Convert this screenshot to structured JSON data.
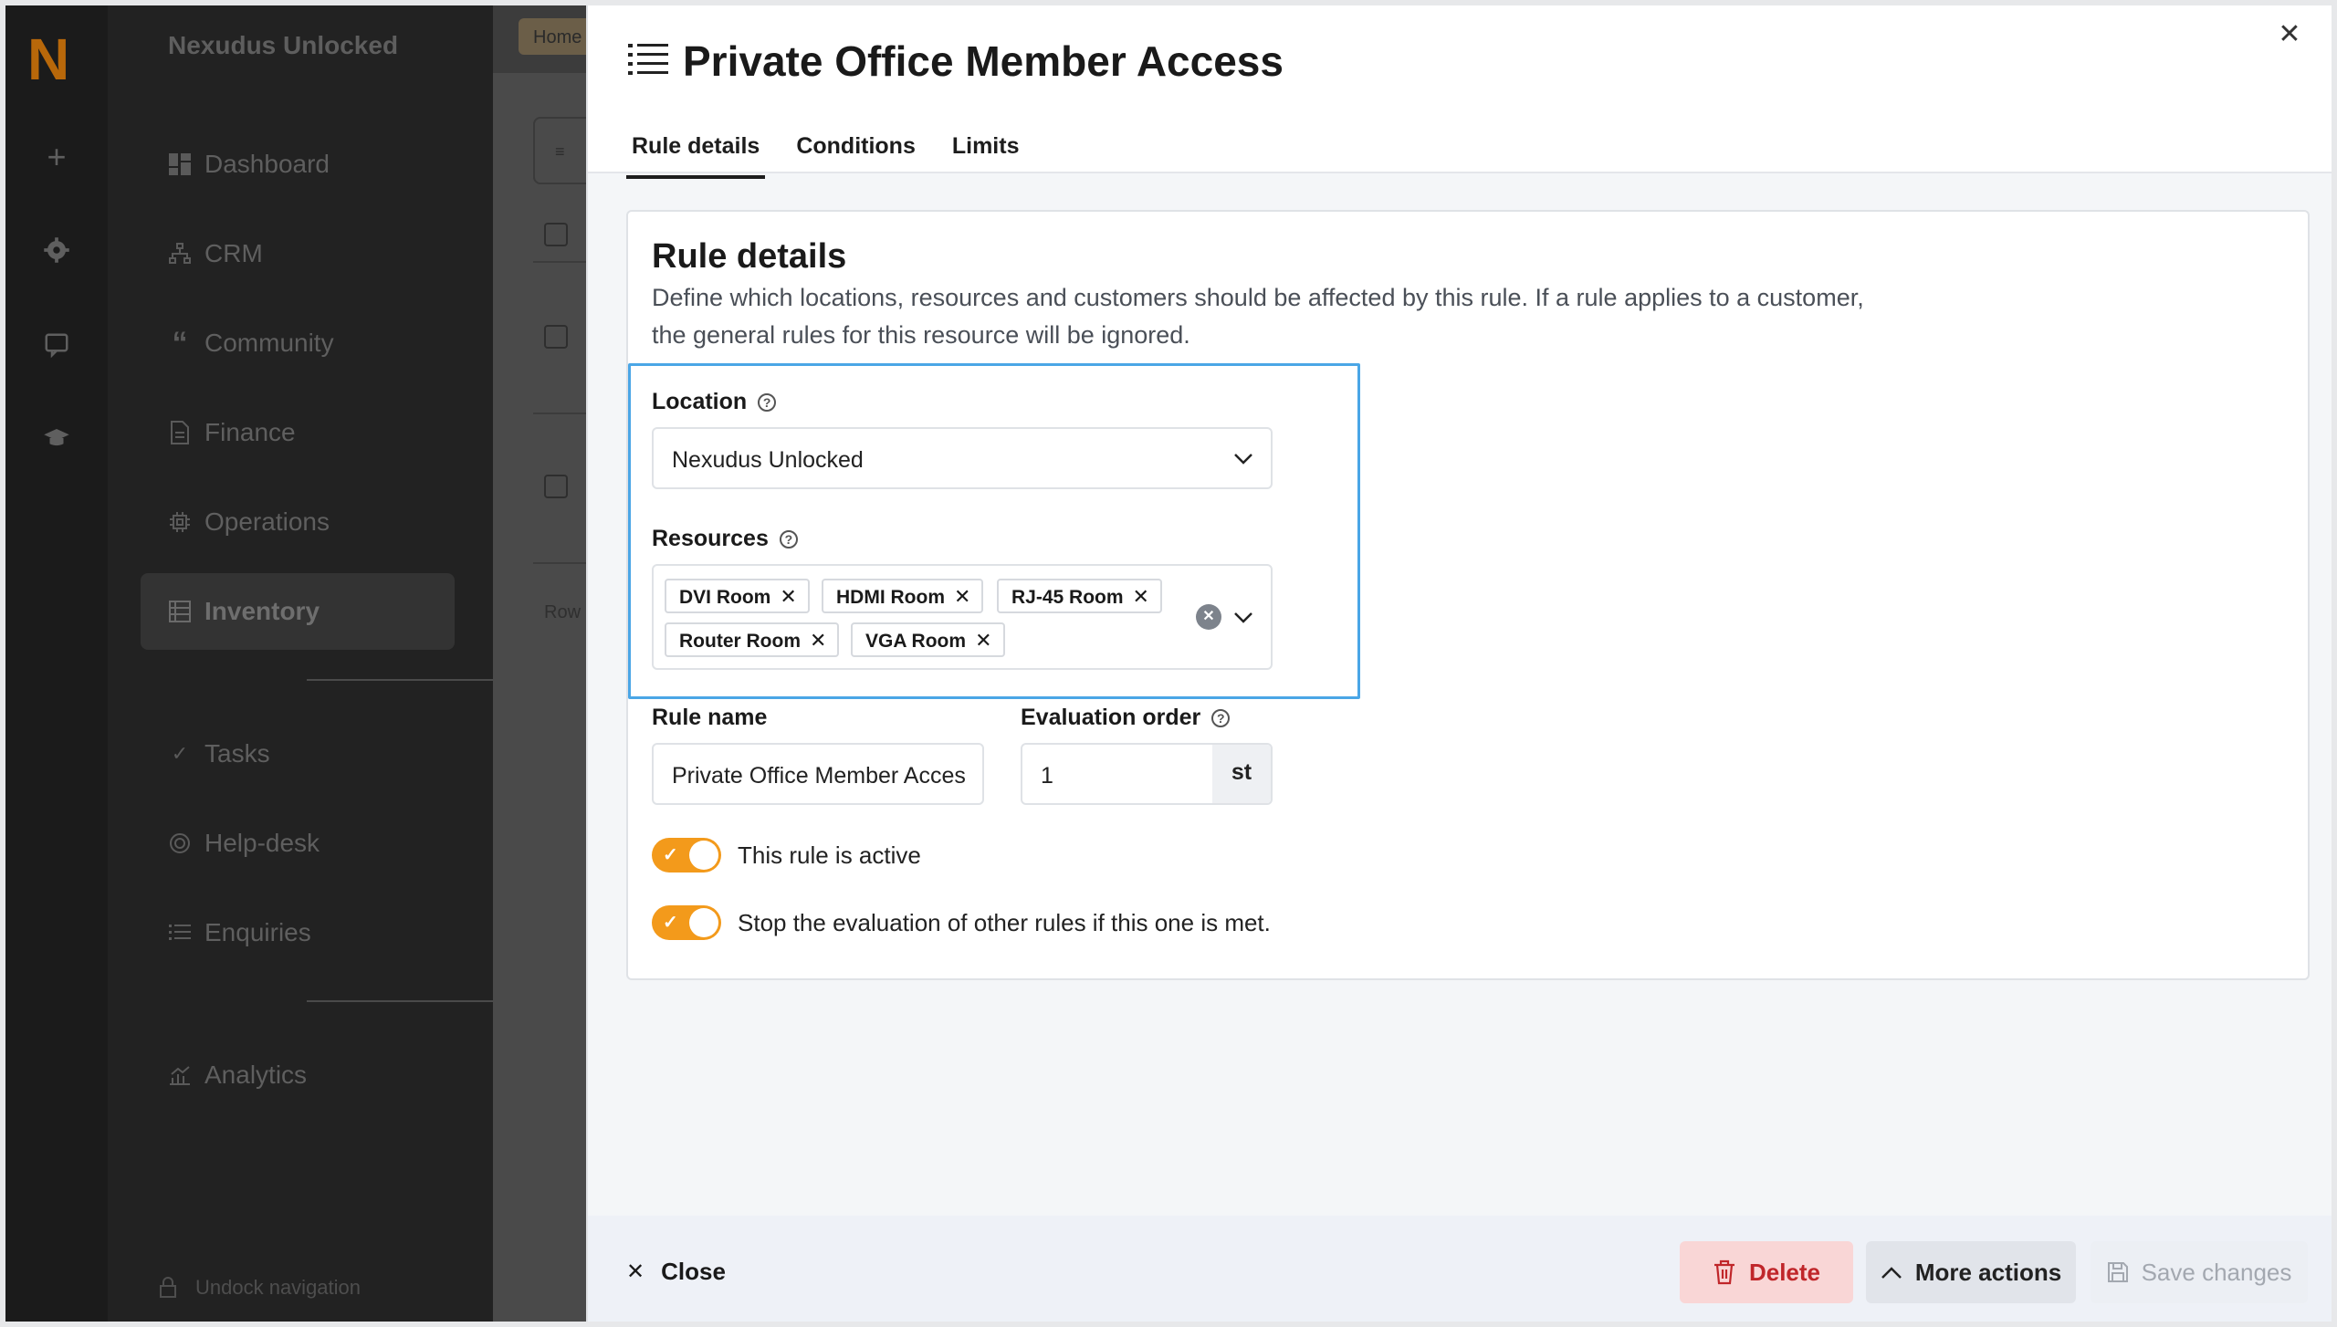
{
  "sidebar": {
    "logo": "N",
    "org_name": "Nexudus Unlocked",
    "items": [
      {
        "label": "Dashboard"
      },
      {
        "label": "CRM"
      },
      {
        "label": "Community"
      },
      {
        "label": "Finance"
      },
      {
        "label": "Operations"
      },
      {
        "label": "Inventory"
      },
      {
        "label": "Tasks"
      },
      {
        "label": "Help-desk"
      },
      {
        "label": "Enquiries"
      },
      {
        "label": "Analytics"
      }
    ],
    "undock": "Undock navigation"
  },
  "background": {
    "breadcrumb_home": "Home",
    "rows_label": "Row"
  },
  "drawer": {
    "title": "Private Office Member Access",
    "tabs": [
      "Rule details",
      "Conditions",
      "Limits"
    ],
    "card": {
      "title": "Rule details",
      "description": "Define which locations, resources and customers should be affected by this rule. If a rule applies to a customer, the general rules for this resource will be ignored.",
      "location_label": "Location",
      "location_value": "Nexudus Unlocked",
      "resources_label": "Resources",
      "resources": [
        "DVI Room",
        "HDMI Room",
        "RJ-45 Room",
        "Router Room",
        "VGA Room"
      ],
      "rule_name_label": "Rule name",
      "rule_name_value": "Private Office Member Acces",
      "evaluation_order_label": "Evaluation order",
      "evaluation_order_value": "1",
      "evaluation_order_suffix": "st",
      "toggle_active_label": "This rule is active",
      "toggle_stop_label": "Stop the evaluation of other rules if this one is met."
    },
    "footer": {
      "close": "Close",
      "delete": "Delete",
      "more_actions": "More actions",
      "save_changes": "Save changes"
    }
  },
  "colors": {
    "accent": "#f39a1b",
    "highlight": "#4aa6e6",
    "delete_text": "#c0262a"
  }
}
